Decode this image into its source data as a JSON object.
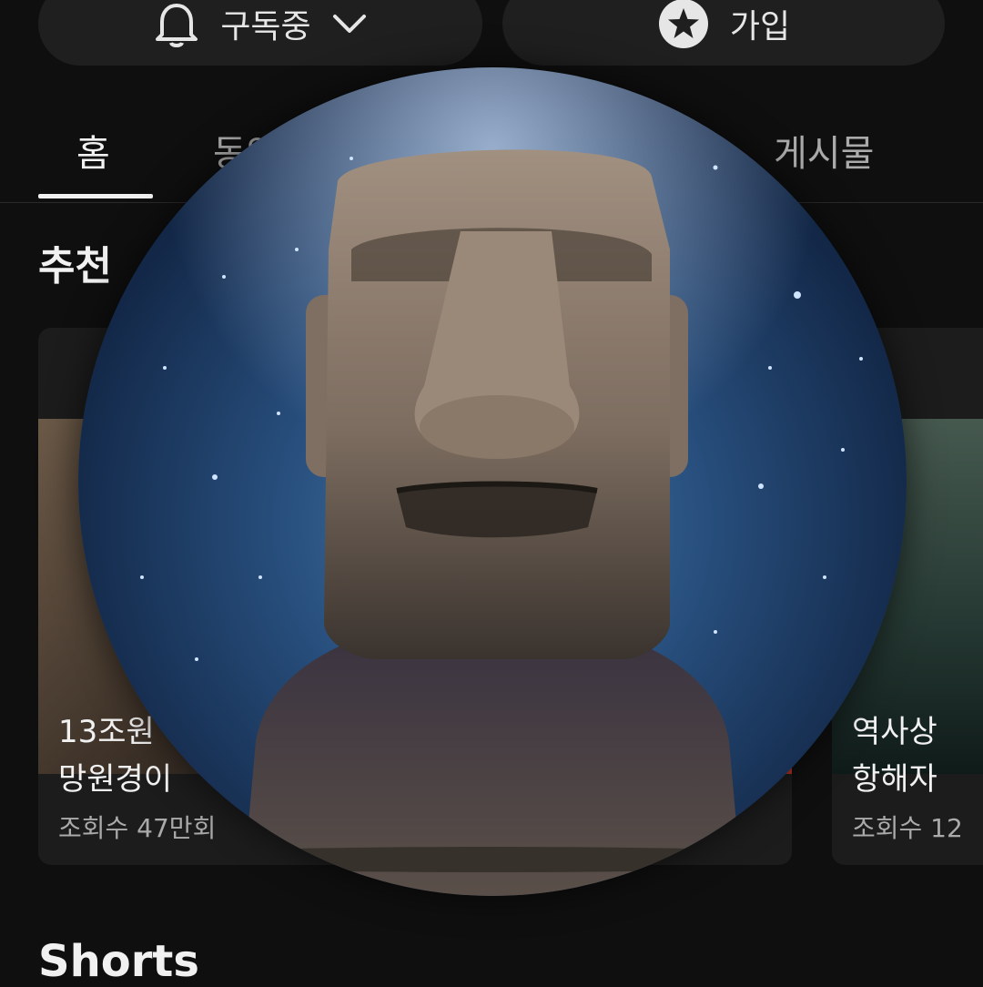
{
  "header": {
    "subscribed_label": "구독중",
    "join_label": "가입"
  },
  "tabs": [
    {
      "label": "홈"
    },
    {
      "label": "동영"
    },
    {
      "label": "게시물"
    }
  ],
  "sections": {
    "recommended_title": "추천",
    "shorts_title": "Shorts"
  },
  "cards": [
    {
      "title": "13조원\n망원경이",
      "meta": "조회수 47만회"
    },
    {
      "title": "역사상 \n항해자",
      "meta": "조회수 12"
    }
  ],
  "avatar": {
    "icon": "moai-statue-avatar"
  },
  "colors": {
    "background": "#0f0f0f",
    "button": "#1f1f1f",
    "text": "#f1f1f1",
    "secondary_text": "#aaaaaa"
  }
}
